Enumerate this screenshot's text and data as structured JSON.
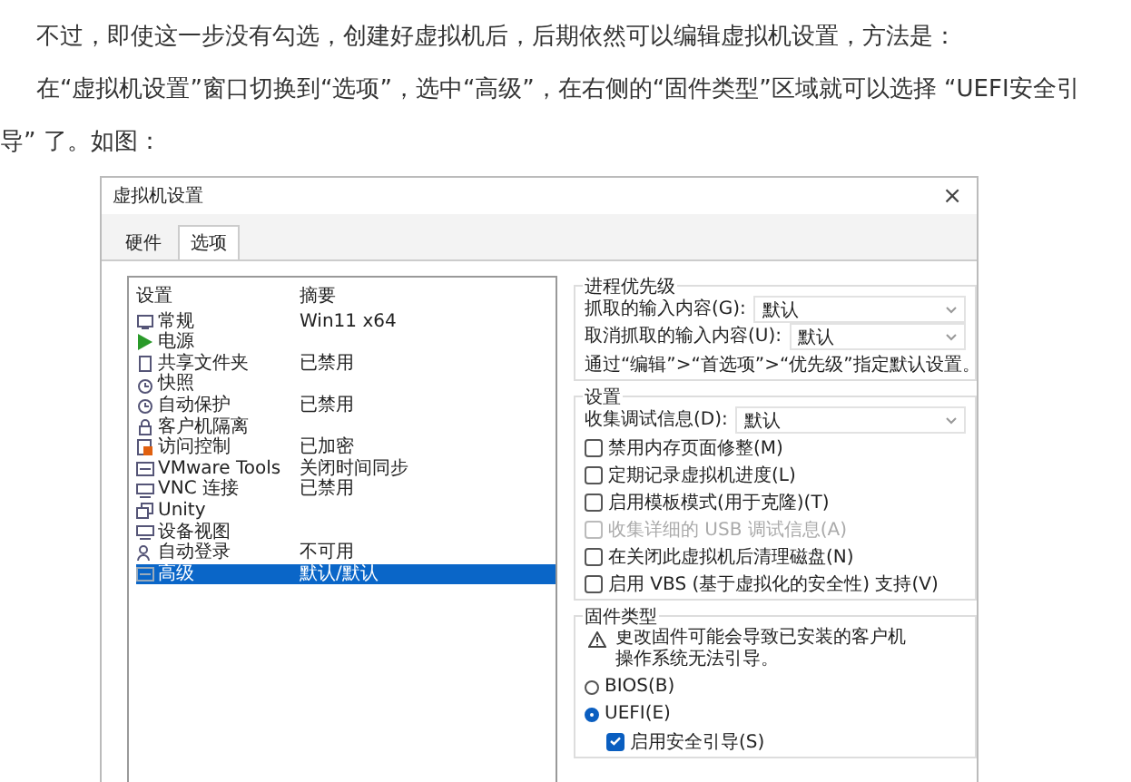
{
  "article": {
    "paragraphs": [
      "不过，即使这一步没有勾选，创建好虚拟机后，后期依然可以编辑虚拟机设置，方法是：",
      "在“虚拟机设置”窗口切换到“选项”，选中“高级”，在右侧的“固件类型”区域就可以选择 “UEFI安全引导” 了。如图："
    ]
  },
  "window": {
    "title": "虚拟机设置",
    "close": "×"
  },
  "tabs": [
    {
      "label": "硬件",
      "selected": false
    },
    {
      "label": "选项",
      "selected": true
    }
  ],
  "settings_list": {
    "columns": [
      "设置",
      "摘要"
    ],
    "rows": [
      {
        "name": "常规",
        "summary": "Win11 x64",
        "selected": false
      },
      {
        "name": "电源",
        "selected": false
      },
      {
        "name": "共享文件夹",
        "summary": "已禁用",
        "selected": false
      },
      {
        "name": "快照",
        "selected": false
      },
      {
        "name": "自动保护",
        "summary": "已禁用",
        "selected": false
      },
      {
        "name": "客户机隔离",
        "selected": false
      },
      {
        "name": "访问控制",
        "summary": "已加密",
        "selected": false
      },
      {
        "name": "VMware Tools",
        "summary": "关闭时间同步",
        "selected": false
      },
      {
        "name": "VNC 连接",
        "summary": "已禁用",
        "selected": false
      },
      {
        "name": "Unity",
        "selected": false
      },
      {
        "name": "设备视图",
        "selected": false
      },
      {
        "name": "自动登录",
        "summary": "不可用",
        "selected": false
      },
      {
        "name": "高级",
        "summary": "默认/默认",
        "selected": true
      }
    ]
  },
  "process_priority": {
    "title": "进程优先级",
    "items": [
      {
        "kind": "dropdown",
        "label": "抓取的输入内容(G):",
        "value": "默认"
      },
      {
        "kind": "dropdown",
        "label": "取消抓取的输入内容(U):",
        "value": "默认"
      },
      {
        "kind": "note",
        "text": "通过“编辑”>“首选项”>“优先级”指定默认设置。"
      }
    ]
  },
  "settings": {
    "title": "设置",
    "items": [
      {
        "kind": "dropdown",
        "label": "收集调试信息(D):",
        "value": "默认"
      },
      {
        "kind": "checkbox",
        "label": "禁用内存页面修整(M)",
        "checked": false,
        "disabled": false
      },
      {
        "kind": "checkbox",
        "label": "定期记录虚拟机进度(L)",
        "checked": false,
        "disabled": false
      },
      {
        "kind": "checkbox",
        "label": "启用模板模式(用于克隆)(T)",
        "checked": false,
        "disabled": false
      },
      {
        "kind": "checkbox",
        "label": "收集详细的 USB 调试信息(A)",
        "checked": false,
        "disabled": true
      },
      {
        "kind": "checkbox",
        "label": "在关闭此虚拟机后清理磁盘(N)",
        "checked": false,
        "disabled": false
      },
      {
        "kind": "checkbox",
        "label": "启用 VBS (基于虚拟化的安全性) 支持(V)",
        "checked": false,
        "disabled": false
      }
    ]
  },
  "firmware_type": {
    "title": "固件类型",
    "items": [
      {
        "kind": "warning",
        "text": "更改固件可能会导致已安装的客户机操作系统无法引导。"
      },
      {
        "kind": "radio",
        "label": "BIOS(B)",
        "selected": false
      },
      {
        "kind": "radio",
        "label": "UEFI(E)",
        "selected": true
      },
      {
        "kind": "checkbox",
        "label": "启用安全引导(S)",
        "checked": true,
        "disabled": false
      }
    ]
  }
}
